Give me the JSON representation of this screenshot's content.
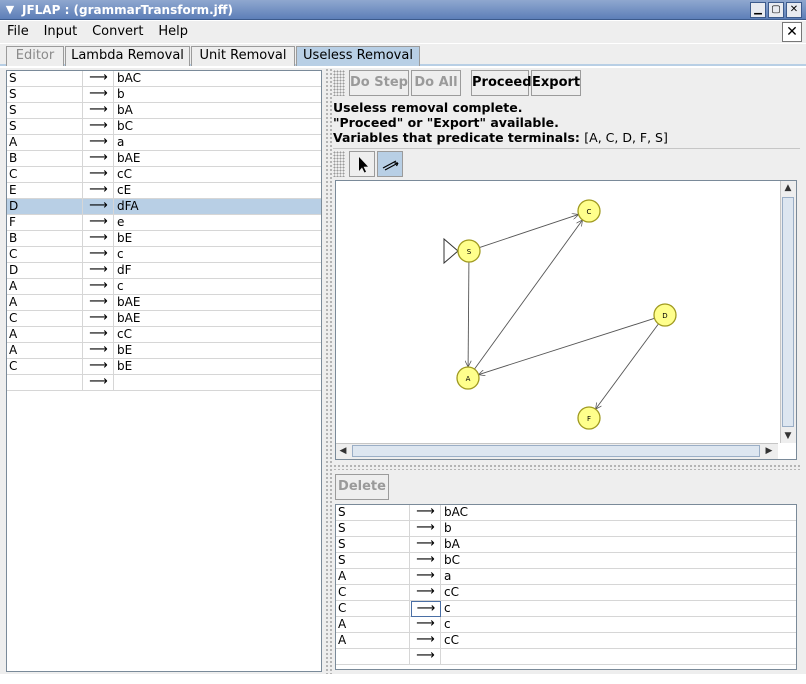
{
  "window": {
    "title": "JFLAP : (grammarTransform.jff)",
    "minimize_glyph": "▁",
    "maximize_glyph": "▢",
    "close_glyph": "✕",
    "sysmenu_glyph": "▼"
  },
  "menubar": {
    "items": [
      "File",
      "Input",
      "Convert",
      "Help"
    ],
    "close_glyph": "✕"
  },
  "tabs": [
    {
      "label": "Editor",
      "state": "disabled"
    },
    {
      "label": "Lambda Removal",
      "state": "normal"
    },
    {
      "label": "Unit Removal",
      "state": "normal"
    },
    {
      "label": "Useless Removal",
      "state": "active"
    }
  ],
  "arrow_glyph": "⟶",
  "grammar": [
    {
      "lhs": "S",
      "rhs": "bAC"
    },
    {
      "lhs": "S",
      "rhs": "b"
    },
    {
      "lhs": "S",
      "rhs": "bA"
    },
    {
      "lhs": "S",
      "rhs": "bC"
    },
    {
      "lhs": "A",
      "rhs": "a"
    },
    {
      "lhs": "B",
      "rhs": "bAE"
    },
    {
      "lhs": "C",
      "rhs": "cC"
    },
    {
      "lhs": "E",
      "rhs": "cE"
    },
    {
      "lhs": "D",
      "rhs": "dFA",
      "selected": true
    },
    {
      "lhs": "F",
      "rhs": "e"
    },
    {
      "lhs": "B",
      "rhs": "bE"
    },
    {
      "lhs": "C",
      "rhs": "c"
    },
    {
      "lhs": "D",
      "rhs": "dF"
    },
    {
      "lhs": "A",
      "rhs": "c"
    },
    {
      "lhs": "A",
      "rhs": "bAE"
    },
    {
      "lhs": "C",
      "rhs": "bAE"
    },
    {
      "lhs": "A",
      "rhs": "cC"
    },
    {
      "lhs": "A",
      "rhs": "bE"
    },
    {
      "lhs": "C",
      "rhs": "bE"
    },
    {
      "lhs": "",
      "rhs": ""
    }
  ],
  "toolbar": {
    "do_step": "Do Step",
    "do_all": "Do All",
    "proceed": "Proceed",
    "export": "Export"
  },
  "status": {
    "line1": "Useless removal complete.",
    "line2": "\"Proceed\" or \"Export\" available.",
    "line3_label": "Variables that predicate terminals:",
    "line3_value": "[A, C, D, F, S]"
  },
  "tools": {
    "pointer_icon": "pointer-tool-icon",
    "edge_icon": "edge-tool-icon"
  },
  "graph": {
    "nodes": [
      {
        "id": "S",
        "initial": true
      },
      {
        "id": "C"
      },
      {
        "id": "D"
      },
      {
        "id": "A"
      },
      {
        "id": "F"
      }
    ],
    "edges": [
      [
        "S",
        "C"
      ],
      [
        "S",
        "A"
      ],
      [
        "A",
        "C"
      ],
      [
        "D",
        "A"
      ],
      [
        "D",
        "F"
      ]
    ],
    "node_color": "#ffff8c",
    "node_stroke": "#a09a20"
  },
  "delete_button": "Delete",
  "result_grammar": [
    {
      "lhs": "S",
      "rhs": "bAC"
    },
    {
      "lhs": "S",
      "rhs": "b"
    },
    {
      "lhs": "S",
      "rhs": "bA"
    },
    {
      "lhs": "S",
      "rhs": "bC"
    },
    {
      "lhs": "A",
      "rhs": "a"
    },
    {
      "lhs": "C",
      "rhs": "cC"
    },
    {
      "lhs": "C",
      "rhs": "c",
      "focused": true
    },
    {
      "lhs": "A",
      "rhs": "c"
    },
    {
      "lhs": "A",
      "rhs": "cC"
    },
    {
      "lhs": "",
      "rhs": ""
    }
  ],
  "colors": {
    "accent": "#b8cfe5",
    "selected_row": "#b8cfe5"
  }
}
